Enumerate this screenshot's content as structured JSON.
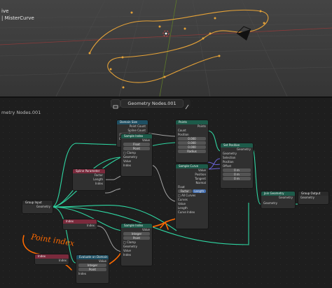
{
  "viewport": {
    "mode_partial": "ive",
    "object_name": "| MisterCurve"
  },
  "node_editor": {
    "tree_name": "Geometry Nodes.001",
    "title_label": "metry Nodes.001"
  },
  "nodes": {
    "domain_size": {
      "title": "Domain Size",
      "outputs": [
        "Point Count",
        "Spline Count"
      ],
      "domain": "Curve",
      "inputs": [
        "Geometry"
      ]
    },
    "points": {
      "title": "Points",
      "outputs": [
        "Points"
      ],
      "inputs": [
        "Count",
        "Position"
      ],
      "values": [
        "0.000",
        "0.000",
        "0.000"
      ],
      "radius_label": "Radius"
    },
    "sample_index_top": {
      "title": "Sample Index",
      "outputs": [
        "Value"
      ],
      "options": [
        "Float",
        "Point"
      ],
      "clamp_label": "Clamp",
      "inputs": [
        "Geometry",
        "Value",
        "Index"
      ]
    },
    "spline_parameter": {
      "title": "Spline Parameter",
      "outputs": [
        "Factor",
        "Length",
        "Index"
      ]
    },
    "sample_curve": {
      "title": "Sample Curve",
      "outputs": [
        "Value",
        "Position",
        "Tangent",
        "Normal"
      ],
      "mode": "Float",
      "tabs": [
        "Factor",
        "Length"
      ],
      "all_curves": "All Curves",
      "inputs": [
        "Curves",
        "Value",
        "Length",
        "Curve Index"
      ]
    },
    "set_position": {
      "title": "Set Position",
      "outputs": [
        "Geometry"
      ],
      "inputs": [
        "Geometry",
        "Selection",
        "Position",
        "Offset"
      ],
      "offset_values": [
        "0 m",
        "0 m",
        "0 m"
      ]
    },
    "group_input": {
      "title": "Group Input",
      "outputs": [
        "Geometry"
      ]
    },
    "join_geometry": {
      "title": "Join Geometry",
      "outputs": [
        "Geometry"
      ],
      "inputs": [
        "Geometry"
      ]
    },
    "group_output": {
      "title": "Group Output",
      "inputs": [
        "Geometry"
      ]
    },
    "index_mid": {
      "title": "Index",
      "outputs": [
        "Index"
      ]
    },
    "sample_index_bottom": {
      "title": "Sample Index",
      "outputs": [
        "Value"
      ],
      "options": [
        "Integer",
        "Point"
      ],
      "clamp_label": "Clamp",
      "inputs": [
        "Geometry",
        "Value",
        "Index"
      ]
    },
    "index_bottom": {
      "title": "Index",
      "outputs": [
        "Index"
      ]
    },
    "evaluate_on_domain": {
      "title": "Evaluate on Domain",
      "outputs": [
        "Value"
      ],
      "options": [
        "Integer",
        "Point"
      ],
      "inputs": [
        "Index"
      ]
    }
  },
  "annotation": {
    "text": "Point index"
  },
  "colors": {
    "geometry_link": "#2fd6a2",
    "float_link": "#a1a1a1",
    "vector_link": "#6b63d8",
    "annotation": "#ff6a00",
    "curve": "#e5a238"
  }
}
